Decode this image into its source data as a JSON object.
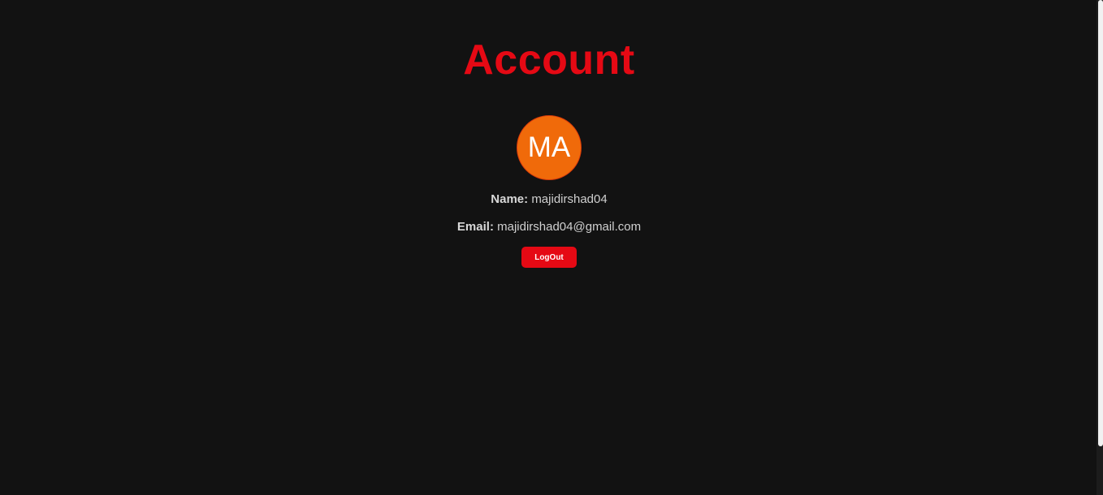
{
  "page": {
    "title": "Account"
  },
  "avatar": {
    "initials": "MA",
    "color": "#f06a0a"
  },
  "profile": {
    "name_label": "Name:",
    "name_value": "majidirshad04",
    "email_label": "Email:",
    "email_value": "majidirshad04@gmail.com"
  },
  "actions": {
    "logout_label": "LogOut"
  },
  "colors": {
    "background": "#121212",
    "accent": "#e50914",
    "text": "#d0d0d0"
  }
}
